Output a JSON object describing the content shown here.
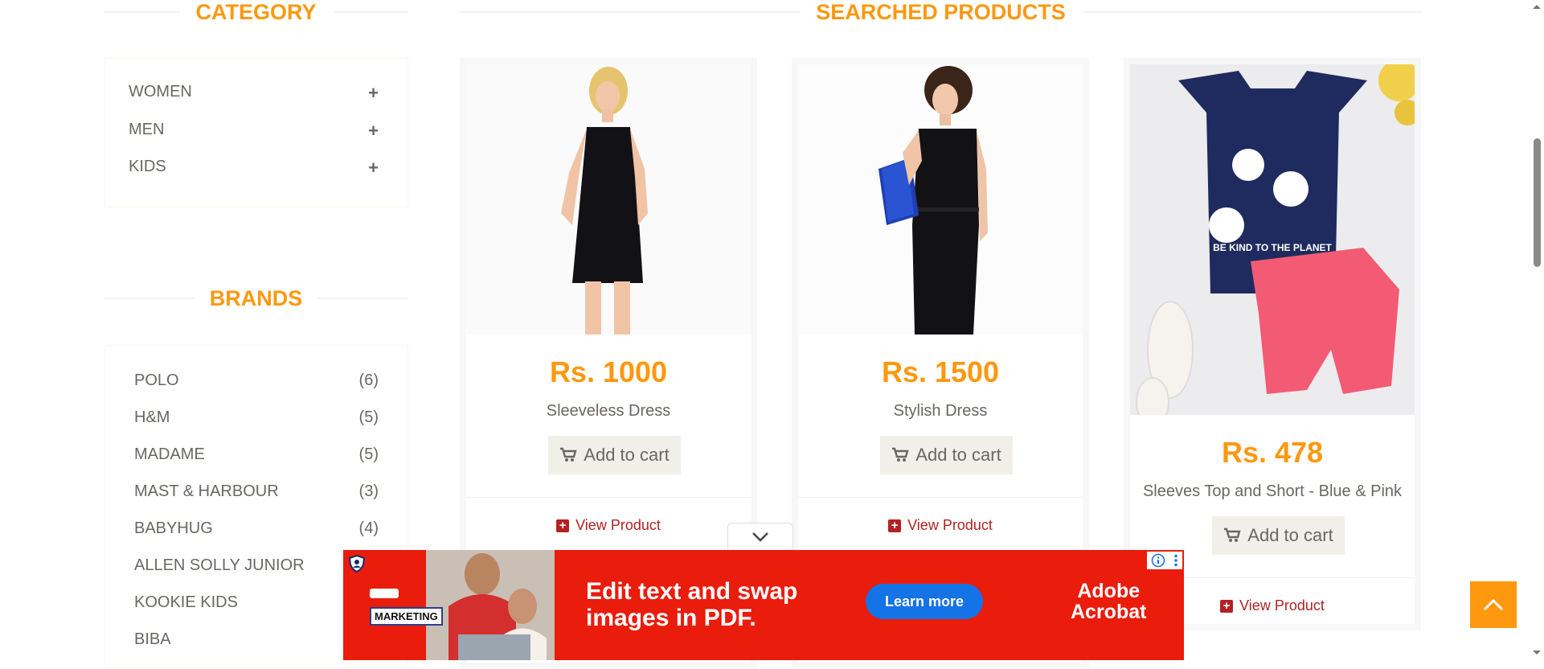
{
  "category": {
    "title": "CATEGORY",
    "items": [
      {
        "label": "WOMEN",
        "toggle": "+"
      },
      {
        "label": "MEN",
        "toggle": "+"
      },
      {
        "label": "KIDS",
        "toggle": "+"
      }
    ]
  },
  "brands": {
    "title": "BRANDS",
    "items": [
      {
        "name": "POLO",
        "count": "(6)"
      },
      {
        "name": "H&M",
        "count": "(5)"
      },
      {
        "name": "MADAME",
        "count": "(5)"
      },
      {
        "name": "MAST & HARBOUR",
        "count": "(3)"
      },
      {
        "name": "BABYHUG",
        "count": "(4)"
      },
      {
        "name": "ALLEN SOLLY JUNIOR",
        "count": ""
      },
      {
        "name": "KOOKIE KIDS",
        "count": ""
      },
      {
        "name": "BIBA",
        "count": ""
      }
    ]
  },
  "products": {
    "title": "SEARCHED PRODUCTS",
    "add_label": "Add to cart",
    "view_label": "View Product",
    "items": [
      {
        "price": "Rs. 1000",
        "name": "Sleeveless Dress"
      },
      {
        "price": "Rs. 1500",
        "name": "Stylish Dress"
      },
      {
        "price": "Rs. 478",
        "name": "Sleeves Top and Short - Blue & Pink",
        "print_text": "BE KIND TO THE PLANET"
      }
    ]
  },
  "ad": {
    "headline_line1": "Edit text and swap",
    "headline_line2": "images in PDF.",
    "cta": "Learn more",
    "brand_line1": "Adobe",
    "brand_line2": "Acrobat",
    "tag_text": "MARKETING"
  },
  "colors": {
    "accent": "#fe980f",
    "link": "#b22222",
    "ad_bg": "#ea1c0c",
    "ad_cta": "#1473e6"
  }
}
